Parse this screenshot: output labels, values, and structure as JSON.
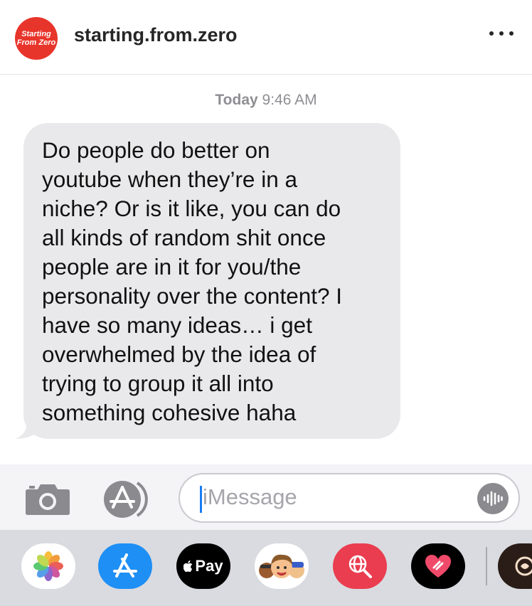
{
  "header": {
    "avatar_line1": "Starting",
    "avatar_line2": "From Zero",
    "username": "starting.from.zero"
  },
  "conversation": {
    "timestamp_day": "Today",
    "timestamp_time": "9:46 AM",
    "messages": [
      {
        "direction": "incoming",
        "lines": [
          "Do people do better on",
          "youtube when they’re in a",
          "niche? Or is it like, you can do",
          "all kinds of random shit once",
          "people are in it for you/the",
          "personality over the content? I",
          "have so many ideas… i get",
          "overwhelmed by the idea of",
          "trying to group it all into",
          "something cohesive haha"
        ]
      }
    ]
  },
  "compose": {
    "placeholder": "iMessage",
    "camera_icon": "camera-icon",
    "apps_icon": "app-store-icon",
    "audio_icon": "audio-waveform-icon"
  },
  "app_drawer": {
    "apps": [
      "photos-icon",
      "app-store-icon",
      "apple-pay-icon",
      "memoji-icon",
      "web-search-icon",
      "digital-touch-icon",
      "partial-app-icon"
    ],
    "apple_pay_label": "Pay"
  },
  "colors": {
    "avatar_red": "#e8352b",
    "bubble_gray": "#e9e9eb",
    "drawer_bg": "#d9dbe0",
    "cursor_blue": "#1a7cf5"
  }
}
